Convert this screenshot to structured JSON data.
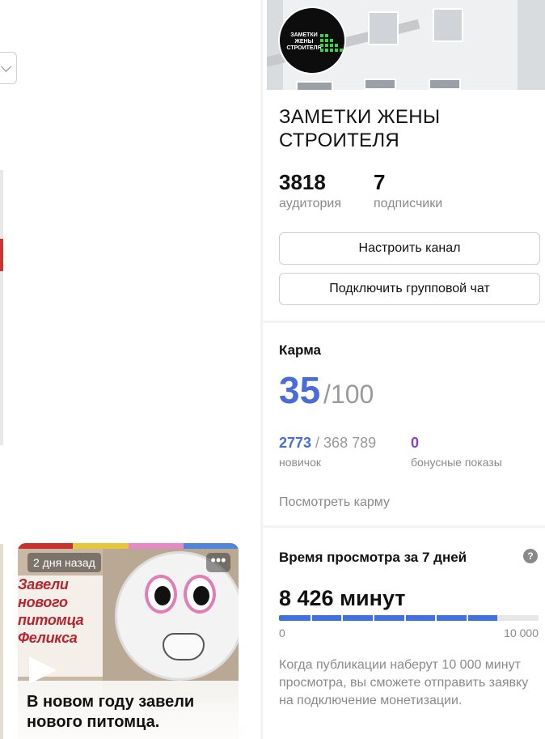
{
  "feed": {
    "card": {
      "time_badge": "2 дня назад",
      "more": "•••",
      "cover_headline": "Завели\nнового\nпитомца\nФеликса",
      "title": "В новом году завели нового питомца."
    }
  },
  "channel": {
    "logo_text": "ЗАМЕТКИ ЖЕНЫ СТРОИТЕЛЯ",
    "title": "ЗАМЕТКИ ЖЕНЫ СТРОИТЕЛЯ",
    "audience_value": "3818",
    "audience_label": "аудитория",
    "subscribers_value": "7",
    "subscribers_label": "подписчики",
    "configure_button": "Настроить канал",
    "group_chat_button": "Подключить групповой чат"
  },
  "karma": {
    "heading": "Карма",
    "score": "35",
    "max": "/100",
    "progress_current": "2773",
    "progress_target": " / 368 789",
    "level_label": "новичок",
    "bonus_value": "0",
    "bonus_label": "бонусные показы",
    "view_link": "Посмотреть карму"
  },
  "views": {
    "heading": "Время просмотра за 7 дней",
    "help": "?",
    "total": "8 426 минут",
    "progress_value": 8426,
    "progress_max": 10000,
    "scale_min": "0",
    "scale_max": "10 000",
    "note": "Когда публикации наберут 10 000 минут просмотра, вы сможете отправить заявку на подключение монетизации."
  },
  "colors": {
    "accent_blue": "#4a6cd8",
    "progress_blue": "#3f72e0",
    "bonus_purple": "#8a3fd1",
    "muted_text": "#8a8a8a"
  }
}
